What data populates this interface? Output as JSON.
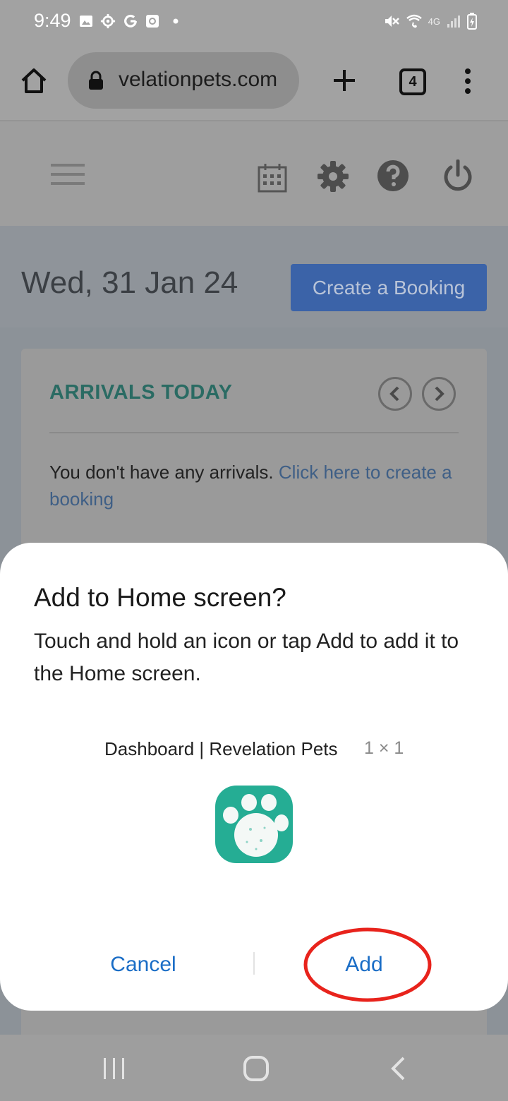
{
  "status_bar": {
    "time": "9:49",
    "left_icons": [
      "image-icon",
      "gear-icon",
      "google-icon",
      "app-icon",
      "dot-icon"
    ],
    "right_icons": [
      "mute-icon",
      "wifi-calling-icon",
      "4g-signal-icon",
      "battery-icon"
    ],
    "network_label": "4G"
  },
  "browser": {
    "url": "velationpets.com",
    "tab_count": "4"
  },
  "app": {
    "date": "Wed, 31 Jan 24",
    "create_booking_label": "Create a Booking",
    "arrivals": {
      "title": "ARRIVALS TODAY",
      "message": "You don't have any arrivals.",
      "link": "Click here to create a booking"
    }
  },
  "dialog": {
    "title": "Add to Home screen?",
    "body": "Touch and hold an icon or tap Add to add it to the Home screen.",
    "shortcut_label": "Dashboard | Revelation Pets",
    "shortcut_size": "1 × 1",
    "cancel_label": "Cancel",
    "add_label": "Add"
  },
  "colors": {
    "accent_blue": "#1a6dc6",
    "highlight_red": "#e8231c",
    "app_icon_green": "#25ad94"
  }
}
